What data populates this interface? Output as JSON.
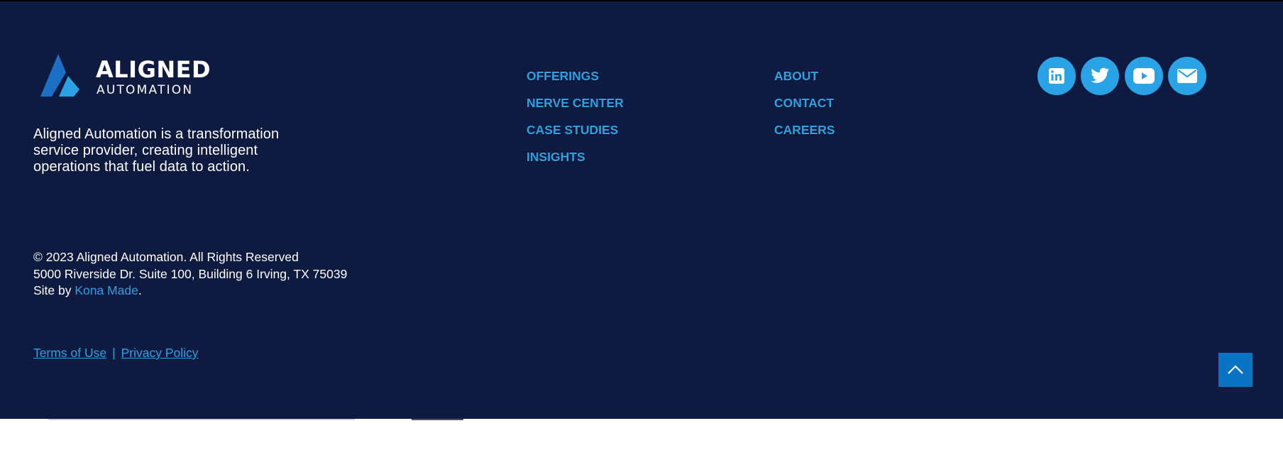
{
  "brand": {
    "name_line1": "ALIGNED",
    "name_line2": "AUTOMATION",
    "colors": {
      "background": "#0e1a40",
      "accent": "#29a3e6",
      "logo_blue_dark": "#1b6fc4",
      "logo_blue_light": "#29a3e6",
      "back_to_top": "#0a73c4"
    }
  },
  "tagline": "Aligned Automation is a transformation service provider, creating intelligent operations that fuel data to action.",
  "nav": {
    "column1": [
      "OFFERINGS",
      "NERVE CENTER",
      "CASE STUDIES",
      "INSIGHTS"
    ],
    "column2": [
      "ABOUT",
      "CONTACT",
      "CAREERS"
    ]
  },
  "social": {
    "icons": [
      "linkedin-icon",
      "twitter-icon",
      "youtube-icon",
      "envelope-icon"
    ]
  },
  "legal": {
    "copyright": "© 2023 Aligned Automation. All Rights Reserved",
    "address": "5000 Riverside Dr. Suite 100, Building 6 Irving, TX 75039",
    "site_by_prefix": "Site by ",
    "site_by_link": "Kona Made",
    "site_by_suffix": "."
  },
  "policy": {
    "terms": "Terms of Use",
    "separator": "|",
    "privacy": "Privacy Policy"
  },
  "back_to_top": {
    "icon": "chevron-up-icon"
  }
}
